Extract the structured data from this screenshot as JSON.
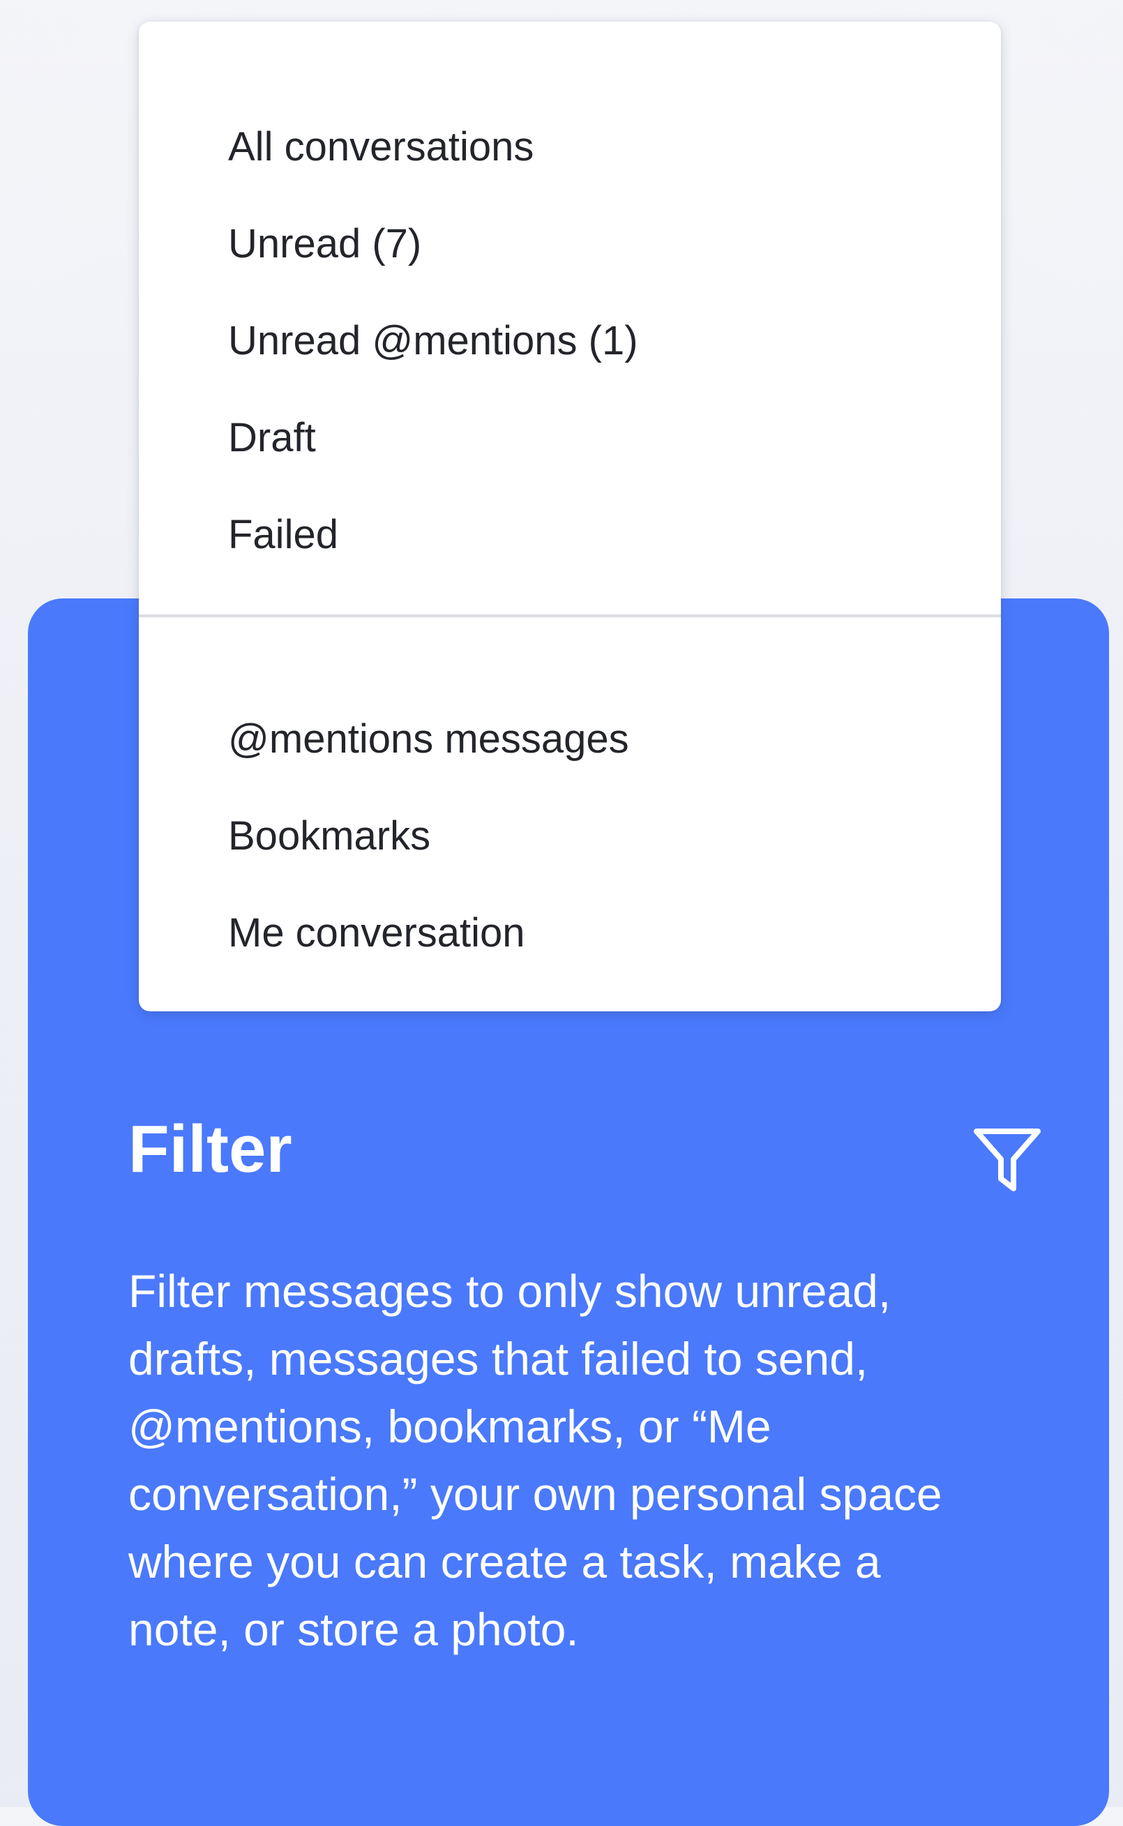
{
  "menu": {
    "primary_items": [
      {
        "label": "All conversations"
      },
      {
        "label": "Unread (7)"
      },
      {
        "label": "Unread @mentions (1)"
      },
      {
        "label": "Draft"
      },
      {
        "label": "Failed"
      }
    ],
    "secondary_items": [
      {
        "label": "@mentions messages"
      },
      {
        "label": "Bookmarks"
      },
      {
        "label": "Me conversation"
      }
    ]
  },
  "card": {
    "title": "Filter",
    "icon": "filter-funnel-icon",
    "description": "Filter messages to only show unread, drafts, messages that failed to send, @mentions, bookmarks, or “Me conversation,” your own personal space where you can create a task, make a note, or store a photo.",
    "background_color": "#4a79fc"
  }
}
